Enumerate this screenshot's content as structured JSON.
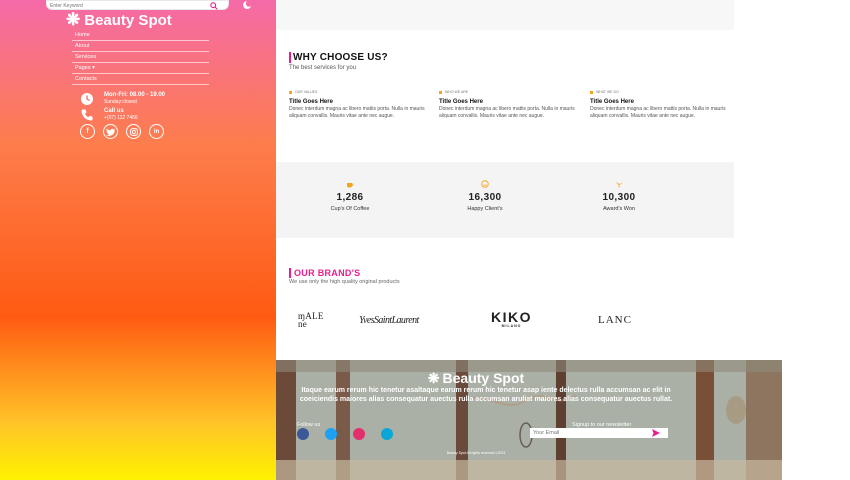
{
  "sidebar": {
    "search_placeholder": "Enter Keyword",
    "brand_star": "❋",
    "brand_name": "Beauty Spot",
    "nav": [
      "Home",
      "About",
      "Services",
      "Pages ▾",
      "Contacts"
    ],
    "hours_line1": "Mon-Fri: 08.00 - 19.00",
    "hours_line2": "Sunday:closed",
    "call_label": "Call us",
    "call_number": "+(07) 112 7466",
    "socials": [
      "facebook-icon",
      "twitter-icon",
      "instagram-icon",
      "linkedin-icon"
    ]
  },
  "why": {
    "title": "WHY CHOOSE US?",
    "subtitle": "The best services for you",
    "features": [
      {
        "category": "OUR VALUES",
        "title": "Title Goes Here",
        "text": "Donec interdum magna ac libero mattis porta. Nulla in mauris aliquam convallis. Mauris vitae ante nec augue."
      },
      {
        "category": "WHO WE ARE",
        "title": "Title Goes Here",
        "text": "Donec interdum magna ac libero mattis porta. Nulla in mauris aliquam convallis. Mauris vitae ante nec augue."
      },
      {
        "category": "WHAT WE DO",
        "title": "Title Goes Here",
        "text": "Donec interdum magna ac libero mattis porta. Nulla in mauris aliquam convallis. Mauris vitae ante nec augue."
      }
    ]
  },
  "stats": [
    {
      "icon": "coffee-icon",
      "number": "1,286",
      "label": "Cup's Of Coffee"
    },
    {
      "icon": "smile-icon",
      "number": "16,300",
      "label": "Happy Client's"
    },
    {
      "icon": "trophy-icon",
      "number": "10,300",
      "label": "Award's Won"
    }
  ],
  "brands": {
    "title": "OUR BRAND'S",
    "subtitle": "We use only the high quality original products",
    "logos": [
      "ɱALE ne",
      "YvesSaintLaurent",
      "KIKO",
      "LANC"
    ],
    "kiko_sub": "MILANO"
  },
  "footer": {
    "brand_star": "❋",
    "brand_name": "Beauty Spot",
    "description": "Itaque earum rerum hic tenetur asaltaque earum rerum hic tenetur asap iente delectus rulla accumsan ac elit in coeiciendis maiores alias consequatur auectus rulla accumsan aruliat maiores alias consequatur auectus rullat.",
    "follow_label": "Follow us",
    "newsletter_label": "Signup to our newsletter",
    "email_placeholder": "Your Email",
    "social_colors": [
      "#3b5998",
      "#1da1f2",
      "#e1306c",
      "#0aa6d8"
    ],
    "copyright": "Beauty Spot All rights reserved | 2023"
  }
}
